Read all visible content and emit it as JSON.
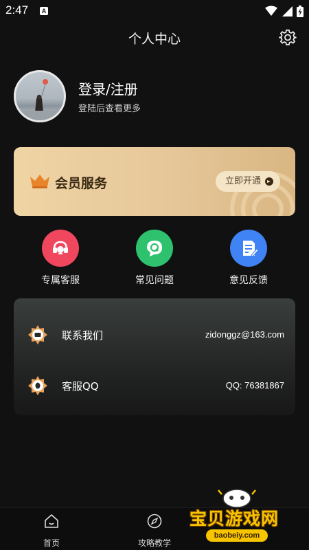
{
  "status_bar": {
    "time": "2:47",
    "notification_icon_letter": "A"
  },
  "header": {
    "title": "个人中心",
    "settings_icon": "gear-icon"
  },
  "profile": {
    "title": "登录/注册",
    "subtitle": "登陆后查看更多"
  },
  "vip": {
    "label": "会员服务",
    "button_label": "立即开通",
    "icon": "crown-icon",
    "accent": "#e6c79a"
  },
  "quick_actions": [
    {
      "label": "专属客服",
      "icon": "headset-icon",
      "color": "#f0475f"
    },
    {
      "label": "常见问题",
      "icon": "question-chat-icon",
      "color": "#2ec26f"
    },
    {
      "label": "意见反馈",
      "icon": "feedback-note-icon",
      "color": "#3f83f5"
    }
  ],
  "contact": [
    {
      "name": "联系我们",
      "value": "zidonggz@163.com",
      "icon": "contact-badge-icon"
    },
    {
      "name": "客服QQ",
      "value": "QQ: 76381867",
      "icon": "qq-badge-icon"
    }
  ],
  "bottom_nav": [
    {
      "label": "首页",
      "icon": "home-icon"
    },
    {
      "label": "攻略教学",
      "icon": "compass-icon"
    }
  ],
  "watermark": {
    "title": "宝贝游戏网",
    "url": "baobeiy.com"
  }
}
